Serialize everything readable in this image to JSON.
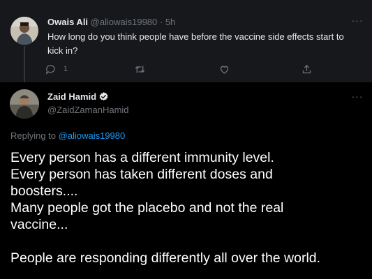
{
  "parent_tweet": {
    "author_name": "Owais Ali",
    "author_handle": "@aliowais19980",
    "separator": " · ",
    "time": "5h",
    "text": "How long do you think people have before the vaccine side effects start to kick in?",
    "reply_count": "1",
    "more_label": "···"
  },
  "main_tweet": {
    "author_name": "Zaid Hamid",
    "author_handle": "@ZaidZamanHamid",
    "more_label": "···",
    "replying_prefix": "Replying to ",
    "replying_to": "@aliowais19980",
    "lines": [
      "Every person has a different immunity level.",
      "Every person has taken different doses and",
      "boosters....",
      "Many people got the placebo and not the real",
      "vaccine...",
      "",
      "People are responding differently all over the world."
    ]
  },
  "colors": {
    "background": "#000000",
    "parent_background": "#16181c",
    "link": "#1d9bf0",
    "muted": "#71767b",
    "text": "#e7e9ea"
  },
  "icons": {
    "reply": "reply-icon",
    "retweet": "retweet-icon",
    "like": "heart-icon",
    "share": "share-icon",
    "verified": "verified-badge-icon",
    "more": "more-icon"
  }
}
